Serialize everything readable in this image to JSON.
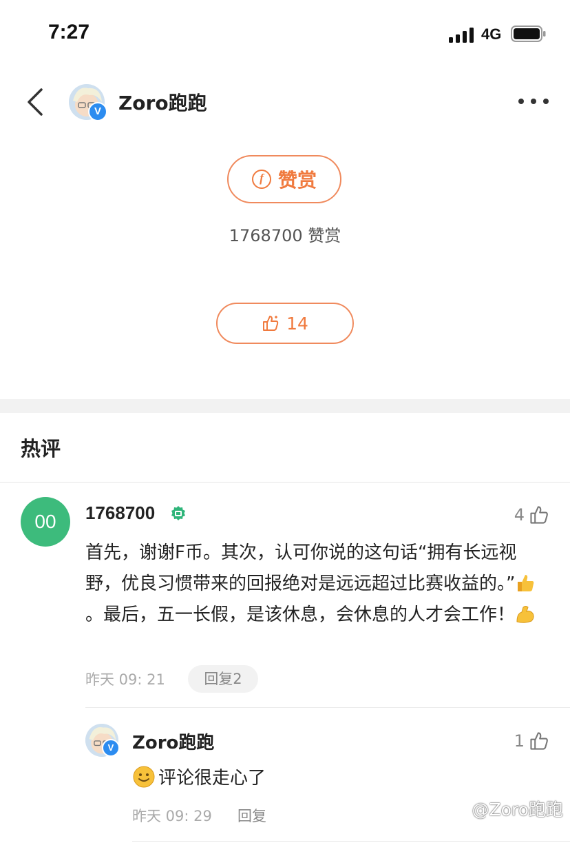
{
  "status_bar": {
    "time": "7:27",
    "network": "4G"
  },
  "header": {
    "username": "Zoro跑跑"
  },
  "reward": {
    "button_label": "赞赏",
    "count_text": "1768700 赞赏"
  },
  "like": {
    "count": "14"
  },
  "hot_comments": {
    "title": "热评",
    "comment": {
      "avatar_text": "00",
      "username": "1768700",
      "likes": "4",
      "text_part1": "首先，谢谢F币。其次，认可你说的这句话“拥有长远视野，优良习惯带来的回报绝对是远远超过比赛收益的。”",
      "text_part2": "。最后，五一长假，是该休息，会休息的人才会工作！",
      "time": "昨天 09: 21",
      "reply_label": "回复2"
    },
    "reply": {
      "username": "Zoro跑跑",
      "likes": "1",
      "text": "评论很走心了",
      "time": "昨天 09: 29",
      "reply_label": "回复"
    }
  },
  "watermark": "@Zoro跑跑",
  "colors": {
    "accent": "#f07a3e",
    "avatar_green": "#3dbb7c",
    "verified_blue": "#2c8cf0"
  }
}
